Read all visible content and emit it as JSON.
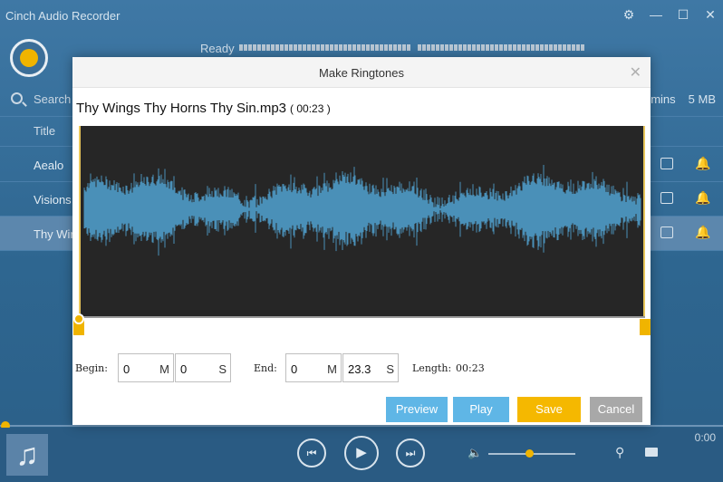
{
  "app": {
    "title": "Cinch Audio Recorder",
    "status": "Ready",
    "search_label": "Search",
    "stats": {
      "minutes": "mins",
      "size": "5 MB"
    },
    "list_header": "Title",
    "tracks": [
      {
        "title": "Aealo",
        "selected": false
      },
      {
        "title": "Visions",
        "selected": false
      },
      {
        "title": "Thy Wir",
        "selected": true
      }
    ],
    "time": "0:00",
    "playback_progress_percent": 0,
    "volume_percent": 47
  },
  "dialog": {
    "title": "Make Ringtones",
    "close_glyph": "✕",
    "file_name": "Thy Wings Thy Horns Thy Sin.mp3",
    "duration": "( 00:23 )",
    "begin": {
      "label": "Begin:",
      "minutes": "0",
      "minutes_unit": "M",
      "seconds": "0",
      "seconds_unit": "S"
    },
    "end": {
      "label": "End:",
      "minutes": "0",
      "minutes_unit": "M",
      "seconds": "23.3",
      "seconds_unit": "S"
    },
    "length": {
      "label": "Length:",
      "value": "00:23"
    },
    "buttons": {
      "preview": "Preview",
      "play": "Play",
      "save": "Save",
      "cancel": "Cancel"
    }
  },
  "icons": {
    "settings": "⚙",
    "minimize": "—",
    "maximize": "☐",
    "close": "✕",
    "music": "♫",
    "prev": "⏮",
    "play": "▶",
    "next": "⏭",
    "volume": "🔈",
    "filter": "⚲",
    "bell": "🔔"
  },
  "colors": {
    "accent": "#f0b400",
    "waveform": "#4a90b8",
    "preview_button": "#5fb6e6",
    "save_button": "#f5b800",
    "cancel_button": "#a8a8a8"
  }
}
